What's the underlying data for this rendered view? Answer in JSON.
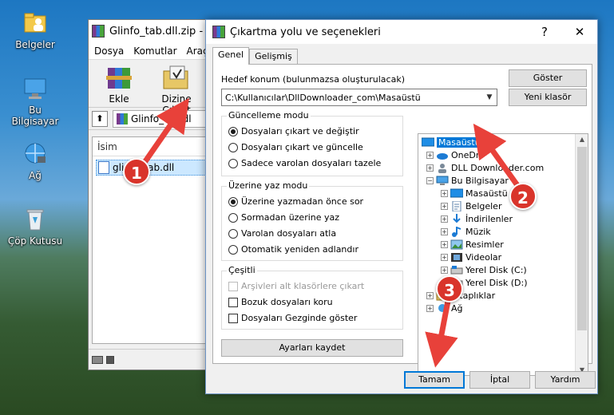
{
  "desktop": {
    "icons": [
      {
        "label": "Belgeler"
      },
      {
        "label": "Bu Bilgisayar"
      },
      {
        "label": "Ağ"
      },
      {
        "label": "Çöp Kutusu"
      }
    ]
  },
  "winrar": {
    "title": "Glinfo_tab.dll.zip - W",
    "menu": [
      "Dosya",
      "Komutlar",
      "Araçla"
    ],
    "toolbar": {
      "add_label": "Ekle",
      "extract_label": "Dizine Çıkart"
    },
    "address": "Glinfo_tab.dl",
    "list_header": "İsim",
    "file_name": "glinfo_tab.dll"
  },
  "dialog": {
    "title": "Çıkartma yolu ve seçenekleri",
    "help_btn": "?",
    "close_btn": "✕",
    "tabs": [
      "Genel",
      "Gelişmiş"
    ],
    "dest_label": "Hedef konum (bulunmazsa oluşturulacak)",
    "dest_value": "C:\\Kullanıcılar\\DllDownloader_com\\Masaüstü",
    "show_button": "Göster",
    "new_folder_button": "Yeni klasör",
    "update_mode": {
      "title": "Güncelleme modu",
      "options": [
        "Dosyaları çıkart ve değiştir",
        "Dosyaları çıkart ve güncelle",
        "Sadece varolan dosyaları tazele"
      ]
    },
    "overwrite_mode": {
      "title": "Üzerine yaz modu",
      "options": [
        "Üzerine yazmadan önce sor",
        "Sormadan üzerine yaz",
        "Varolan dosyaları atla",
        "Otomatik yeniden adlandır"
      ]
    },
    "misc": {
      "title": "Çeşitli",
      "options": [
        "Arşivleri alt klasörlere çıkart",
        "Bozuk dosyaları koru",
        "Dosyaları Gezginde göster"
      ]
    },
    "save_settings": "Ayarları kaydet",
    "tree": [
      {
        "label": "Masaüstü"
      },
      {
        "label": "OneDri"
      },
      {
        "label": "DLL Downloader.com"
      },
      {
        "label": "Bu Bilgisayar"
      },
      {
        "label": "Masaüstü"
      },
      {
        "label": "Belgeler"
      },
      {
        "label": "İndirilenler"
      },
      {
        "label": "Müzik"
      },
      {
        "label": "Resimler"
      },
      {
        "label": "Videolar"
      },
      {
        "label": "Yerel Disk (C:)"
      },
      {
        "label": "Yerel Disk (D:)"
      },
      {
        "label": "Kitaplıklar"
      },
      {
        "label": "Ağ"
      }
    ],
    "ok_button": "Tamam",
    "cancel_button": "İptal",
    "help_button": "Yardım"
  },
  "annotations": [
    "1",
    "2",
    "3"
  ],
  "colors": {
    "accent": "#0078d7",
    "badge": "#d9342b"
  }
}
